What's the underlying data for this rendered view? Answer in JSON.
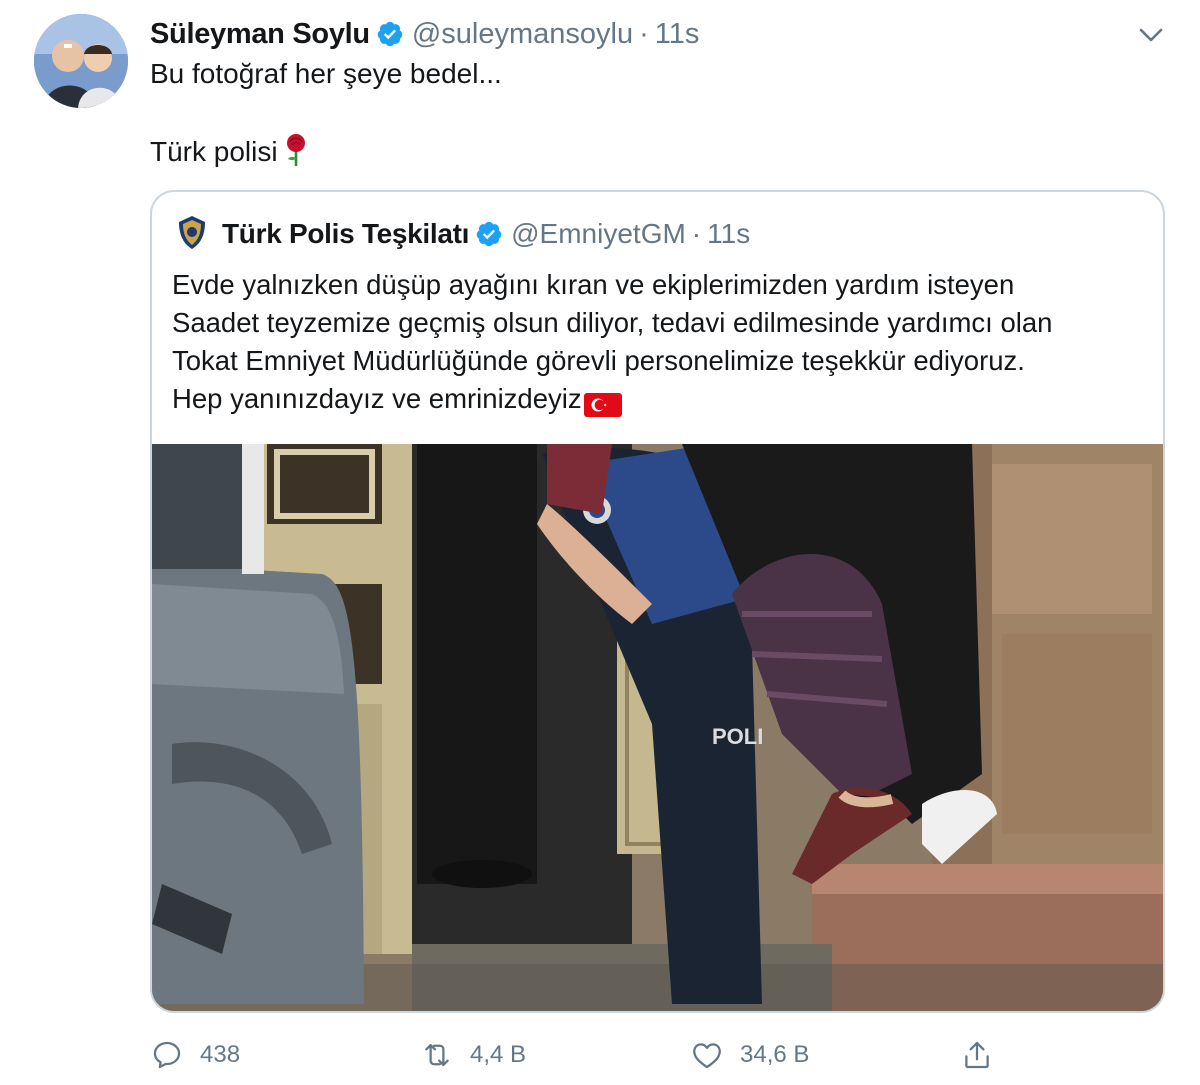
{
  "tweet": {
    "author_name": "Süleyman Soylu",
    "author_handle": "@suleymansoylu",
    "separator": "·",
    "time": "11s",
    "text_line_1": "Bu fotoğraf her şeye bedel...",
    "text_line_2": "Türk polisi",
    "text_line_2_emoji": "rose-emoji"
  },
  "quoted_tweet": {
    "author_name": "Türk Polis Teşkilatı",
    "author_handle": "@EmniyetGM",
    "separator": "·",
    "time": "11s",
    "lines": [
      "Evde yalnızken düşüp ayağını kıran ve ekiplerimizden yardım isteyen",
      "Saadet teyzemize geçmiş olsun diliyor, tedavi edilmesinde yardımcı olan",
      "Tokat Emniyet Müdürlüğünde görevli personelimize teşekkür ediyoruz.",
      "Hep yanınızdayız ve emrinizdeyiz"
    ],
    "trailing_emoji": "turkish-flag-emoji",
    "photo_caption_visible": "POLI"
  },
  "actions": {
    "reply_count": "438",
    "retweet_count": "4,4 B",
    "like_count": "34,6 B"
  },
  "colors": {
    "verified": "#1da1f2",
    "secondary_text": "#657786",
    "border": "#ccd6dd",
    "flag_red": "#e30a17"
  }
}
